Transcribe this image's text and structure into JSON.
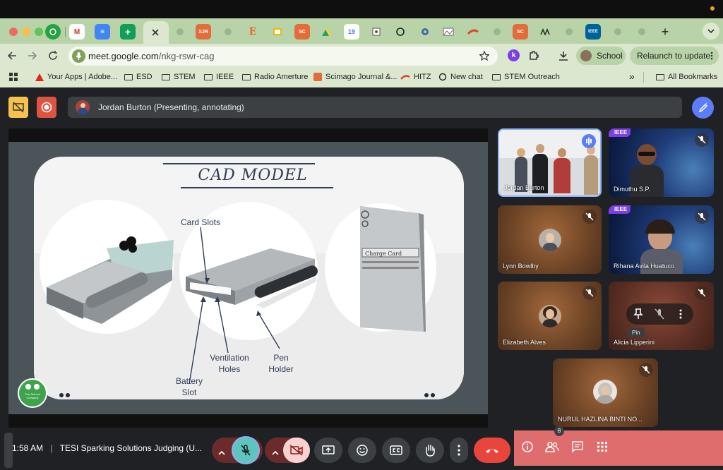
{
  "browser": {
    "tabs": [
      {
        "icon": "whatsapp-icon",
        "color": "#25a244"
      },
      {
        "icon": "gmail-icon",
        "color": "#d93025"
      },
      {
        "icon": "google-docs-icon",
        "color": "#4285f4"
      },
      {
        "icon": "google-sheets-icon",
        "color": "#0f9d58"
      },
      {
        "icon": "google-meet-icon",
        "color": "#8aa27a"
      },
      {
        "icon": "scimago-icon",
        "color": "#e36c3a"
      },
      {
        "icon": "globe-icon",
        "color": "#8aa27a"
      },
      {
        "icon": "etsy-icon",
        "color": "#f1641e"
      },
      {
        "icon": "google-slides-icon",
        "color": "#f4b400"
      },
      {
        "icon": "scimago-icon",
        "color": "#e36c3a"
      },
      {
        "icon": "google-drive-icon",
        "color": "#1fa463"
      },
      {
        "icon": "calendar-icon",
        "color": "#4285f4"
      },
      {
        "icon": "reader-icon",
        "color": "#555555"
      },
      {
        "icon": "chatgpt-icon",
        "color": "#222222"
      },
      {
        "icon": "gear-icon",
        "color": "#3a6ea5"
      },
      {
        "icon": "photo-icon",
        "color": "#666666"
      },
      {
        "icon": "hitz-icon",
        "color": "#d94a2f"
      },
      {
        "icon": "globe-icon",
        "color": "#8aa27a"
      },
      {
        "icon": "scimago-icon",
        "color": "#e36c3a"
      },
      {
        "icon": "app-icon",
        "color": "#333333"
      },
      {
        "icon": "globe-icon",
        "color": "#8aa27a"
      },
      {
        "icon": "ieee-icon",
        "color": "#00629b"
      },
      {
        "icon": "globe-icon",
        "color": "#8aa27a"
      },
      {
        "icon": "globe-icon",
        "color": "#8aa27a"
      }
    ],
    "tab_text": {
      "gmail": "M",
      "docs": "≡",
      "sheets": "+",
      "scimago": "SJR",
      "etsy": "E",
      "sc": "SC",
      "calendar": "19",
      "ieee": "IEEE"
    },
    "new_tab": "+",
    "url_host": "meet.google.com",
    "url_path": "/nkg-rswr-cag",
    "profile_label": "School",
    "relaunch_label": "Relaunch to update",
    "bookmarks": [
      {
        "label": "Your Apps | Adobe...",
        "icon": "adobe-icon"
      },
      {
        "label": "ESD",
        "icon": "folder-icon"
      },
      {
        "label": "STEM",
        "icon": "folder-icon"
      },
      {
        "label": "IEEE",
        "icon": "folder-icon"
      },
      {
        "label": "Radio Amerture",
        "icon": "folder-icon"
      },
      {
        "label": "Scimago Journal &...",
        "icon": "scimago-icon"
      },
      {
        "label": "HITZ",
        "icon": "hitz-icon"
      },
      {
        "label": "New chat",
        "icon": "chatgpt-icon"
      },
      {
        "label": "STEM Outreach",
        "icon": "folder-icon"
      }
    ],
    "overflow": "»",
    "all_bookmarks": "All Bookmarks"
  },
  "meet": {
    "presenter_text": "Jordan Burton (Presenting, annotating)",
    "slide": {
      "title": "CAD MODEL",
      "label_card_slots": "Card Slots",
      "label_battery": [
        "Battery",
        "Slot"
      ],
      "label_ventilation": [
        "Ventilation",
        "Holes"
      ],
      "label_pen": [
        "Pen",
        "Holder"
      ],
      "device_text": "Charge Card",
      "logo_text": [
        "The Serious",
        "Company"
      ]
    },
    "participants": [
      {
        "name": "Jordan Burton",
        "speaking": true
      },
      {
        "name": "Dimuthu S.P.",
        "badge": "IEEE",
        "muted": true
      },
      {
        "name": "Lynn Bowlby",
        "muted": true
      },
      {
        "name": "Rihana Avila Huatuco",
        "badge": "IEEE",
        "muted": true
      },
      {
        "name": "Elizabeth Alves",
        "muted": true
      },
      {
        "name": "Alicia Lipperini",
        "muted": true
      },
      {
        "name": "NURUL HAZLINA BINTI NO...",
        "muted": true
      }
    ],
    "pin_tooltip": "Pin",
    "clock": "1:58 AM",
    "separator": "|",
    "meeting_title": "TESI Sparking Solutions Judging (U...",
    "people_count": "8",
    "colors": {
      "end_call": "#e8453c",
      "panel": "#e06d6d",
      "mic_muted": "#5fc4be",
      "cam_off": "#f9d2d0",
      "accent": "#5c7cfa"
    }
  }
}
